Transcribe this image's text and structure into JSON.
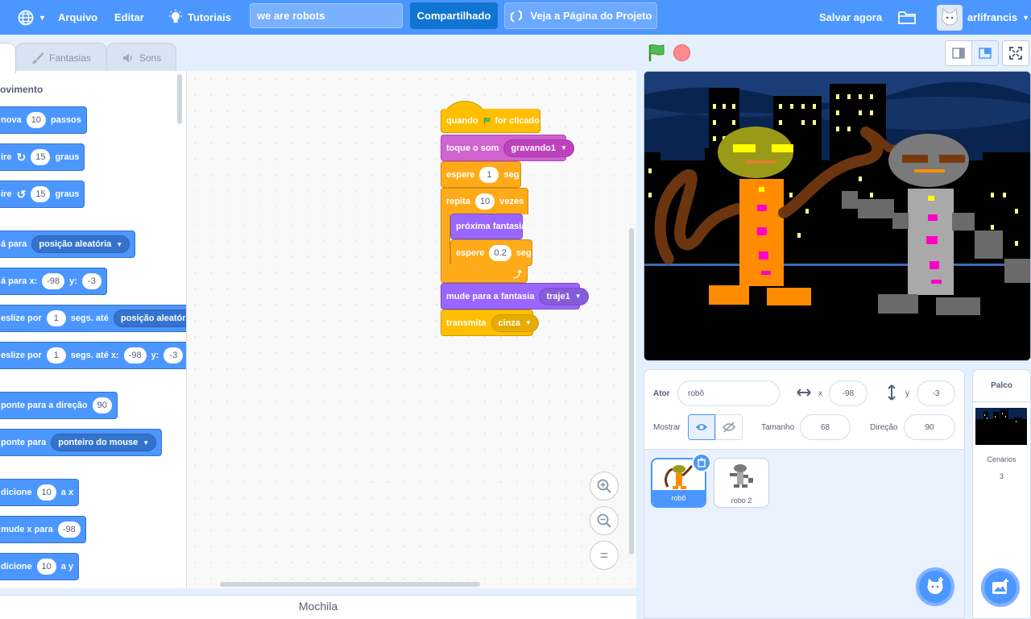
{
  "menubar": {
    "file": "Arquivo",
    "edit": "Editar",
    "tutorials": "Tutoriais",
    "project_title": "we are robots",
    "share": "Compartilhado",
    "see_project_page": "Veja a Página do Projeto",
    "save_now": "Salvar agora",
    "username": "arlifrancis"
  },
  "tabs": {
    "code": "",
    "costumes": "Fantasias",
    "sounds": "Sons"
  },
  "palette": {
    "category": "ovimento",
    "blocks": [
      {
        "a": "nova",
        "n1": "10",
        "b": "passos"
      },
      {
        "a": "ire",
        "n1": "15",
        "b": "graus"
      },
      {
        "a": "ire",
        "n1": "15",
        "b": "graus"
      },
      {
        "a": "á para",
        "dd": "posição aleatória"
      },
      {
        "a": "á para x:",
        "n1": "-98",
        "b": "y:",
        "n2": "-3"
      },
      {
        "a": "eslize por",
        "n1": "1",
        "b": "segs. até",
        "dd": "posição aleatória"
      },
      {
        "a": "eslize por",
        "n1": "1",
        "b": "segs. até x:",
        "n2": "-98",
        "c": "y:",
        "n3": "-3"
      },
      {
        "a": "ponte  para a direção",
        "n1": "90"
      },
      {
        "a": "ponte para",
        "dd": "ponteiro do mouse"
      },
      {
        "a": "dicione",
        "n1": "10",
        "b": "a x"
      },
      {
        "a": "mude x para",
        "n1": "-98"
      },
      {
        "a": "dicione",
        "n1": "10",
        "b": "a y"
      }
    ]
  },
  "script": {
    "when_flag": "quando",
    "when_flag_b": "for clicado",
    "play_sound": "toque o som",
    "sound_name": "gravando1",
    "wait1": "espere",
    "wait1_val": "1",
    "wait1_unit": "seg",
    "repeat": "repita",
    "repeat_val": "10",
    "repeat_unit": "vezes",
    "next_costume": "próxima fantasia",
    "wait2": "espere",
    "wait2_val": "0.2",
    "wait2_unit": "seg",
    "switch_costume": "mude para a fantasia",
    "costume_name": "traje1",
    "broadcast": "transmita",
    "broadcast_msg": "cinza"
  },
  "backpack": "Mochila",
  "sprite_info": {
    "sprite_label": "Ator",
    "sprite_name": "robô",
    "x_label": "x",
    "x_value": "-98",
    "y_label": "y",
    "y_value": "-3",
    "show_label": "Mostrar",
    "size_label": "Tamanho",
    "size_value": "68",
    "direction_label": "Direção",
    "direction_value": "90"
  },
  "sprites": [
    {
      "name": "robô",
      "selected": true
    },
    {
      "name": "robo 2",
      "selected": false
    }
  ],
  "stage_panel": {
    "title": "Palco",
    "backdrops_label": "Cenários",
    "backdrops_count": "3"
  },
  "colors": {
    "menubar": "#4c97ff",
    "motion": "#4c97ff",
    "events": "#ffbf00",
    "sound": "#cf63cf",
    "control": "#ffab19",
    "looks": "#9966ff"
  }
}
